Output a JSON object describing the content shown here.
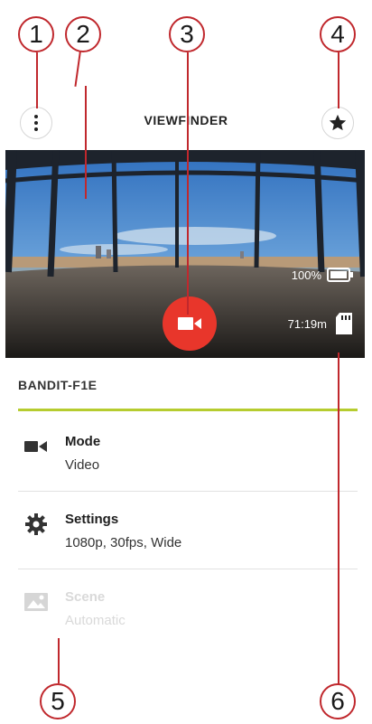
{
  "header": {
    "title": "VIEWFINDER"
  },
  "viewfinder": {
    "battery_text": "100%",
    "battery_level": 1.0,
    "time_remaining": "71:19m"
  },
  "device": {
    "name": "BANDIT-F1E"
  },
  "list": [
    {
      "label": "Mode",
      "value": "Video",
      "icon": "video-camera-icon",
      "enabled": true
    },
    {
      "label": "Settings",
      "value": "1080p, 30fps, Wide",
      "icon": "gear-icon",
      "enabled": true
    },
    {
      "label": "Scene",
      "value": "Automatic",
      "icon": "image-icon",
      "enabled": false
    }
  ],
  "callouts": [
    "1",
    "2",
    "3",
    "4",
    "5",
    "6"
  ],
  "colors": {
    "accent_line": "#b6cc2f",
    "record_button": "#e8362b",
    "callout_outline": "#c0282d"
  }
}
